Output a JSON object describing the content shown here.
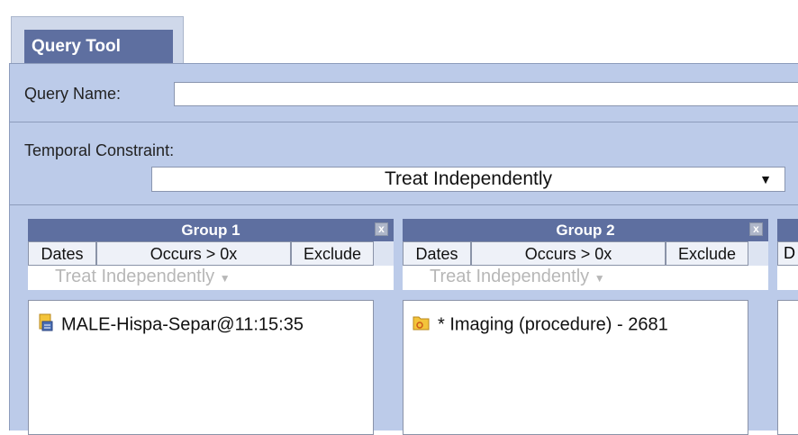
{
  "tab": {
    "title": "Query Tool"
  },
  "query_name": {
    "label": "Query Name:",
    "value": ""
  },
  "temporal": {
    "label": "Temporal Constraint:",
    "selected": "Treat Independently"
  },
  "groups": [
    {
      "title": "Group 1",
      "tabs": {
        "dates": "Dates",
        "occurs": "Occurs > 0x",
        "exclude": "Exclude"
      },
      "temporal": "Treat Independently",
      "item": "MALE-Hispa-Separ@11:15:35"
    },
    {
      "title": "Group 2",
      "tabs": {
        "dates": "Dates",
        "occurs": "Occurs > 0x",
        "exclude": "Exclude"
      },
      "temporal": "Treat Independently",
      "item": "* Imaging (procedure) - 2681"
    }
  ],
  "group3_peek": {
    "dates_partial": "D"
  },
  "colors": {
    "header": "#5e6fa0",
    "panel": "#bccbe9"
  },
  "icons": {
    "close": "close-icon",
    "dropdown": "chevron-down-icon",
    "item1": "previous-query-icon",
    "item2": "folder-term-icon"
  }
}
